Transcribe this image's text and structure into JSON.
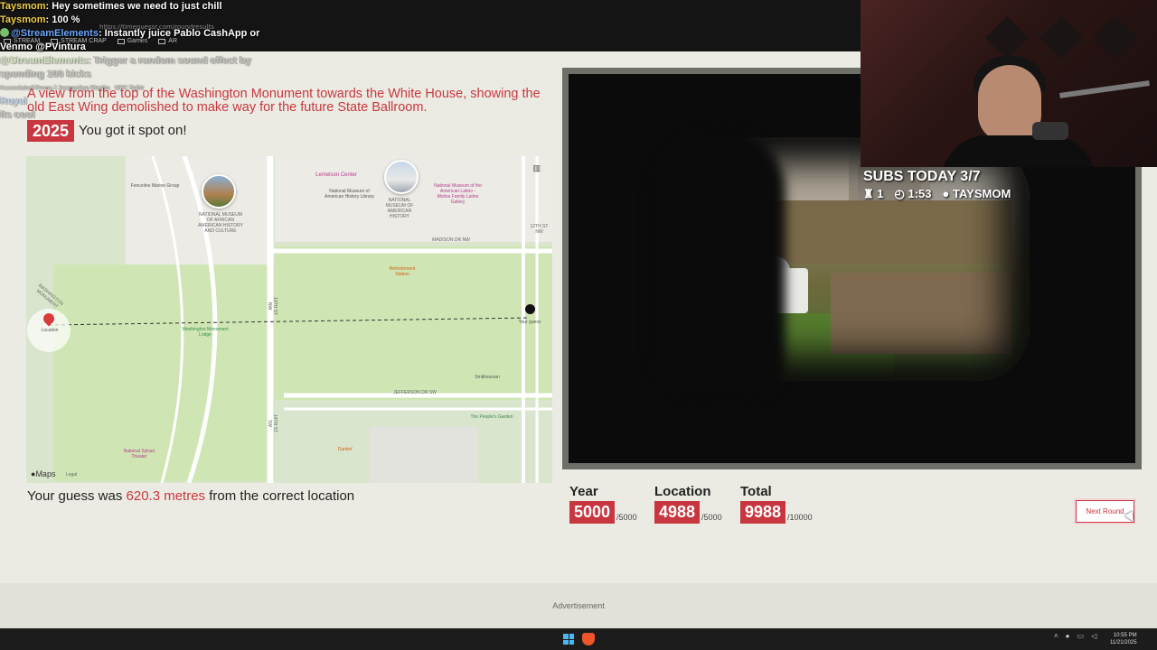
{
  "browser": {
    "url": "https://timeguessr.com/roundresults",
    "bookmarks": [
      "STREAM",
      "STREAM CRAP",
      "Games",
      "AR"
    ]
  },
  "chat": [
    {
      "user": "Taysmom",
      "message": ": Hey sometimes we need to just chill"
    },
    {
      "user": "Taysmom",
      "message": ": 100 %"
    },
    {
      "user": "@StreamElements",
      "message": ": Instantly juice Pablo CashApp or"
    },
    {
      "user": "",
      "message": "Venmo @PVintura"
    },
    {
      "user": "@StreamElements",
      "message": ": Trigger a random sound effect by"
    },
    {
      "user": "",
      "message": "spending 100 kicks"
    },
    {
      "user": "",
      "message": "Associated Press / Jacquelyn Martin"
    },
    {
      "user": "",
      "message": "UFC fight"
    },
    {
      "user": "Royal",
      "message": ""
    },
    {
      "user": "",
      "message": "its cool"
    }
  ],
  "round": {
    "caption": "A view from the top of the Washington Monument towards the White House, showing the old East Wing demolished to make way for the future State Ballroom.",
    "year": "2025",
    "year_feedback": "You got it spot on!",
    "guess_prefix": "Your guess was ",
    "guess_distance": "620.3 metres",
    "guess_suffix": " from the correct location"
  },
  "map": {
    "labels": {
      "carousel": "Fenceline Marine Group",
      "museum_african_american": "NATIONAL MUSEUM OF AFRICAN AMERICAN HISTORY AND CULTURE",
      "lemelson": "Lemelson Center",
      "nmah_library": "National Museum of American History Library",
      "nmah": "NATIONAL MUSEUM OF AMERICAN HISTORY",
      "latino": "National Museum of the American Latino - Molina Family Latino Gallery",
      "madison": "MADISON DR NW",
      "refreshment": "Refreshment Station",
      "monument_lodge": "Washington Monument Lodge",
      "fourteenth_nw": "14TH ST NW",
      "fourteenth_sw": "14TH ST SW",
      "smithsonian": "Smithsonian",
      "jefferson": "JEFFERSON DR SW",
      "peoples_garden": "The People's Garden",
      "sylvan": "National Sylvan Theater",
      "dunkin": "Dunkin'",
      "location": "Location",
      "your_guess": "Your guess",
      "twelfth": "12TH ST NW",
      "washington_monument": "WASHINGTON MONUMENT"
    },
    "provider": "Maps",
    "legal": "Legal"
  },
  "stream_overlay": {
    "subs": "SUBS TODAY 3/7",
    "count": "1",
    "timer": "1:53",
    "user": "TAYSMOM"
  },
  "scores": [
    {
      "label": "Year",
      "value": "5000",
      "max": "/5000"
    },
    {
      "label": "Location",
      "value": "4988",
      "max": "/5000"
    },
    {
      "label": "Total",
      "value": "9988",
      "max": "/10000"
    }
  ],
  "next_button": "Next Round",
  "ad_label": "Advertisement",
  "taskbar": {
    "time": "10:55 PM",
    "date": "11/21/2025"
  },
  "colors": {
    "accent": "#c8373f",
    "page_bg": "#ecebe3"
  }
}
